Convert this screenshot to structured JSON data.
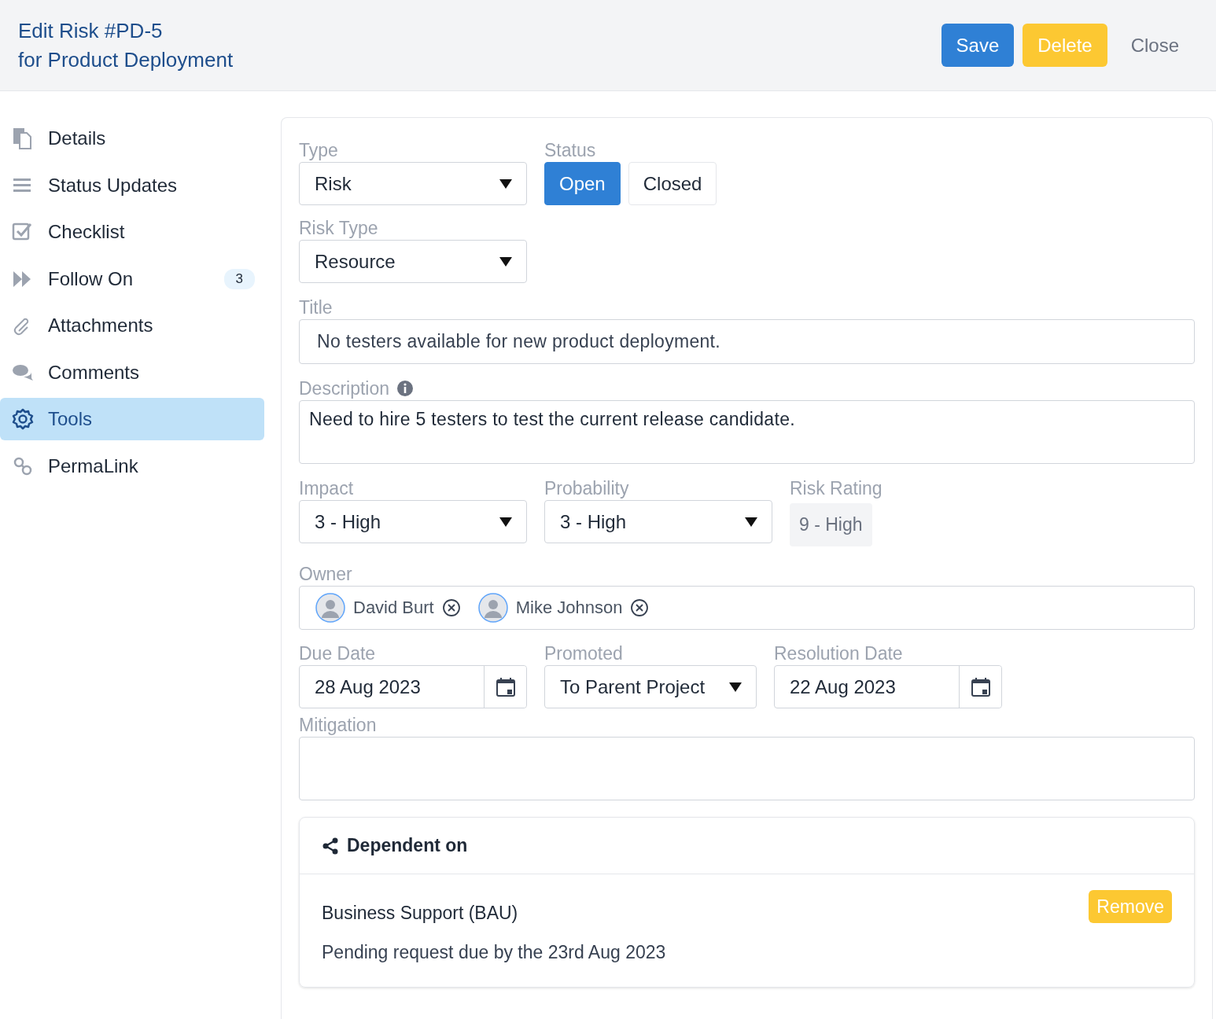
{
  "header": {
    "title_lines": [
      "Edit Risk #PD-5",
      "for Product Deployment"
    ],
    "buttons": [
      {
        "label": "Save",
        "kind": "primary"
      },
      {
        "label": "Delete",
        "kind": "warning"
      },
      {
        "label": "Close",
        "kind": "link"
      }
    ]
  },
  "sidebar": {
    "items": [
      {
        "label": "Details",
        "kind": "details",
        "selected": false
      },
      {
        "label": "Status Updates",
        "kind": "list",
        "selected": false
      },
      {
        "label": "Checklist",
        "kind": "checklist",
        "selected": false
      },
      {
        "label": "Follow On",
        "kind": "forward",
        "selected": false,
        "badge": "3"
      },
      {
        "label": "Attachments",
        "kind": "attachment",
        "selected": false
      },
      {
        "label": "Comments",
        "kind": "comments",
        "selected": false
      },
      {
        "label": "Tools",
        "kind": "tools",
        "selected": true
      },
      {
        "label": "PermaLink",
        "kind": "link",
        "selected": false
      }
    ]
  },
  "form": {
    "type": {
      "label": "Type",
      "value": "Risk"
    },
    "status": {
      "label": "Status",
      "options": [
        {
          "label": "Open",
          "selected": true
        },
        {
          "label": "Closed",
          "selected": false
        }
      ]
    },
    "risk_type": {
      "label": "Risk Type",
      "value": "Resource"
    },
    "title": {
      "label": "Title",
      "value": "No testers available for new product deployment."
    },
    "description": {
      "label": "Description",
      "value": "Need to hire 5 testers to test the current release candidate."
    },
    "impact": {
      "label": "Impact",
      "value": "3 - High"
    },
    "probability": {
      "label": "Probability",
      "value": "3 - High"
    },
    "risk_rating": {
      "label": "Risk Rating",
      "value": "9 - High"
    },
    "owner": {
      "label": "Owner",
      "people": [
        "David Burt",
        "Mike Johnson"
      ]
    },
    "due_date": {
      "label": "Due Date",
      "value": "28 Aug 2023"
    },
    "promoted": {
      "label": "Promoted",
      "value": "To Parent Project"
    },
    "resolution_date": {
      "label": "Resolution Date",
      "value": "22 Aug 2023"
    },
    "mitigation": {
      "label": "Mitigation"
    },
    "dependent": {
      "title": "Dependent on",
      "items": [
        {
          "name": "Business Support (BAU)",
          "note": "Pending request due by the 23rd Aug 2023",
          "button": "Remove"
        }
      ]
    }
  }
}
